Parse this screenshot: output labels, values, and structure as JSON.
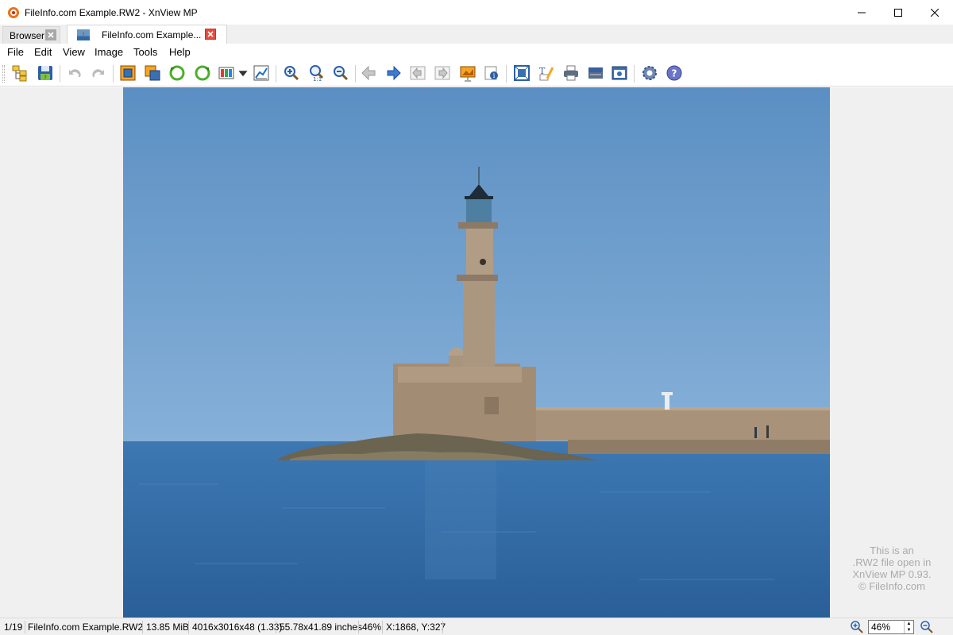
{
  "window": {
    "title": "FileInfo.com Example.RW2 - XnView MP"
  },
  "tabs": [
    {
      "label": "Browser",
      "active": false
    },
    {
      "label": "FileInfo.com Example...",
      "active": true
    }
  ],
  "menu": [
    "File",
    "Edit",
    "View",
    "Image",
    "Tools",
    "Help"
  ],
  "toolbar": {
    "icons": [
      "browser-icon",
      "save-icon",
      "undo-icon",
      "redo-icon",
      "crop-icon",
      "resize-icon",
      "rotate-left-icon",
      "rotate-right-icon",
      "color-adjust-icon",
      "dropdown-arrow-icon",
      "levels-icon",
      "zoom-in-icon",
      "zoom-actual-size-icon",
      "zoom-out-icon",
      "previous-icon",
      "next-icon",
      "first-icon",
      "last-icon",
      "slideshow-icon",
      "info-icon",
      "fit-window-icon",
      "edit-text-icon",
      "print-icon",
      "scan-icon",
      "capture-icon",
      "settings-icon",
      "help-icon"
    ]
  },
  "watermark": {
    "lines": [
      "This is an",
      ".RW2 file open in",
      "XnView MP 0.93.",
      "© FileInfo.com"
    ]
  },
  "status": {
    "index": "1/19",
    "filename": "FileInfo.com Example.RW2",
    "filesize": "13.85 MiB",
    "dimensions": "4016x3016x48 (1.33)",
    "print_size": "55.78x41.89 inches",
    "zoom_percent": "46%",
    "cursor": "X:1868, Y:327",
    "zoom_field": "46%"
  },
  "colors": {
    "accent": "#1e6fc2",
    "sky": "#5b8fc3",
    "sea": "#2e67a3",
    "stone": "#a89279",
    "close_red": "#e74c3c"
  }
}
